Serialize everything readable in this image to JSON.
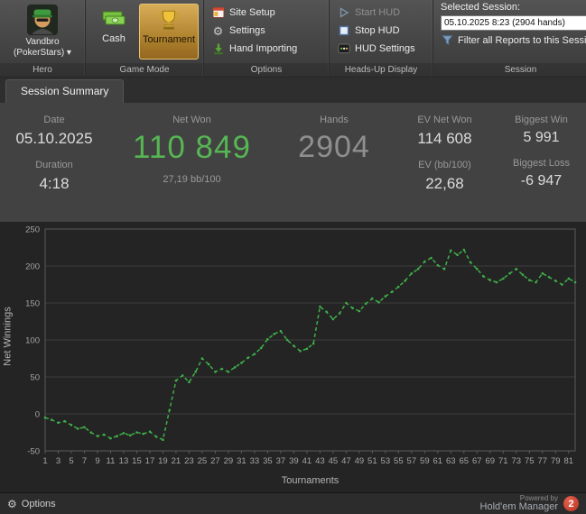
{
  "colors": {
    "accent_green": "#3fae49",
    "net_won_green": "#56b654",
    "tournament_highlight": "#c89b4a",
    "logo_red": "#c0392b",
    "chart_background": "#242424"
  },
  "ribbon": {
    "hero": {
      "name_line1": "Vandbro",
      "name_line2": "(PokerStars) ▾",
      "group_label": "Hero"
    },
    "game_mode": {
      "cash_label": "Cash",
      "tournament_label": "Tournament",
      "group_label": "Game Mode"
    },
    "options": {
      "site_setup": "Site Setup",
      "settings": "Settings",
      "hand_importing": "Hand Importing",
      "group_label": "Options"
    },
    "hud": {
      "start": "Start HUD",
      "stop": "Stop HUD",
      "settings": "HUD Settings",
      "group_label": "Heads-Up Display"
    },
    "session": {
      "selected_label": "Selected Session:",
      "selected_value": "05.10.2025 8:23 (2904 hands)",
      "filter_label": "Filter all Reports to this Session",
      "group_label": "Session"
    }
  },
  "tabs": [
    {
      "label": "Session Summary",
      "active": true
    }
  ],
  "stats": {
    "date": {
      "label": "Date",
      "value": "05.10.2025"
    },
    "duration": {
      "label": "Duration",
      "value": "4:18"
    },
    "net_won": {
      "label": "Net Won",
      "value": "110 849",
      "sub": "27,19 bb/100"
    },
    "hands": {
      "label": "Hands",
      "value": "2904"
    },
    "ev_net_won": {
      "label": "EV Net Won",
      "value": "114 608"
    },
    "ev_bb": {
      "label": "EV (bb/100)",
      "value": "22,68"
    },
    "biggest_win": {
      "label": "Biggest Win",
      "value": "5 991"
    },
    "biggest_loss": {
      "label": "Biggest Loss",
      "value": "-6 947"
    }
  },
  "chart_data": {
    "type": "line",
    "title": "",
    "xlabel": "Tournaments",
    "ylabel": "Net Winnings",
    "ylim": [
      -50,
      250
    ],
    "ytick_step": 50,
    "grid": true,
    "xticks": [
      1,
      3,
      5,
      7,
      9,
      11,
      13,
      15,
      17,
      19,
      21,
      23,
      25,
      27,
      29,
      31,
      33,
      35,
      37,
      39,
      41,
      43,
      45,
      47,
      49,
      51,
      53,
      55,
      57,
      59,
      61,
      63,
      65,
      67,
      69,
      71,
      73,
      75,
      77,
      79,
      81
    ],
    "series": [
      {
        "name": "Net Winnings",
        "color": "#3fae49",
        "values": [
          -5,
          -8,
          -12,
          -10,
          -15,
          -20,
          -18,
          -25,
          -30,
          -28,
          -33,
          -30,
          -26,
          -29,
          -25,
          -27,
          -24,
          -31,
          -35,
          5,
          45,
          52,
          43,
          57,
          75,
          67,
          57,
          61,
          57,
          63,
          69,
          76,
          81,
          89,
          101,
          108,
          112,
          100,
          92,
          85,
          88,
          95,
          145,
          138,
          128,
          136,
          150,
          143,
          139,
          149,
          156,
          151,
          159,
          165,
          172,
          180,
          190,
          196,
          206,
          211,
          201,
          196,
          221,
          215,
          222,
          205,
          196,
          186,
          181,
          178,
          183,
          190,
          196,
          188,
          181,
          178,
          190,
          185,
          180,
          175,
          183,
          178
        ]
      }
    ]
  },
  "statusbar": {
    "options_label": "Options",
    "powered_by": "Powered by",
    "brand": "Hold'em Manager",
    "logo_text": "2"
  }
}
